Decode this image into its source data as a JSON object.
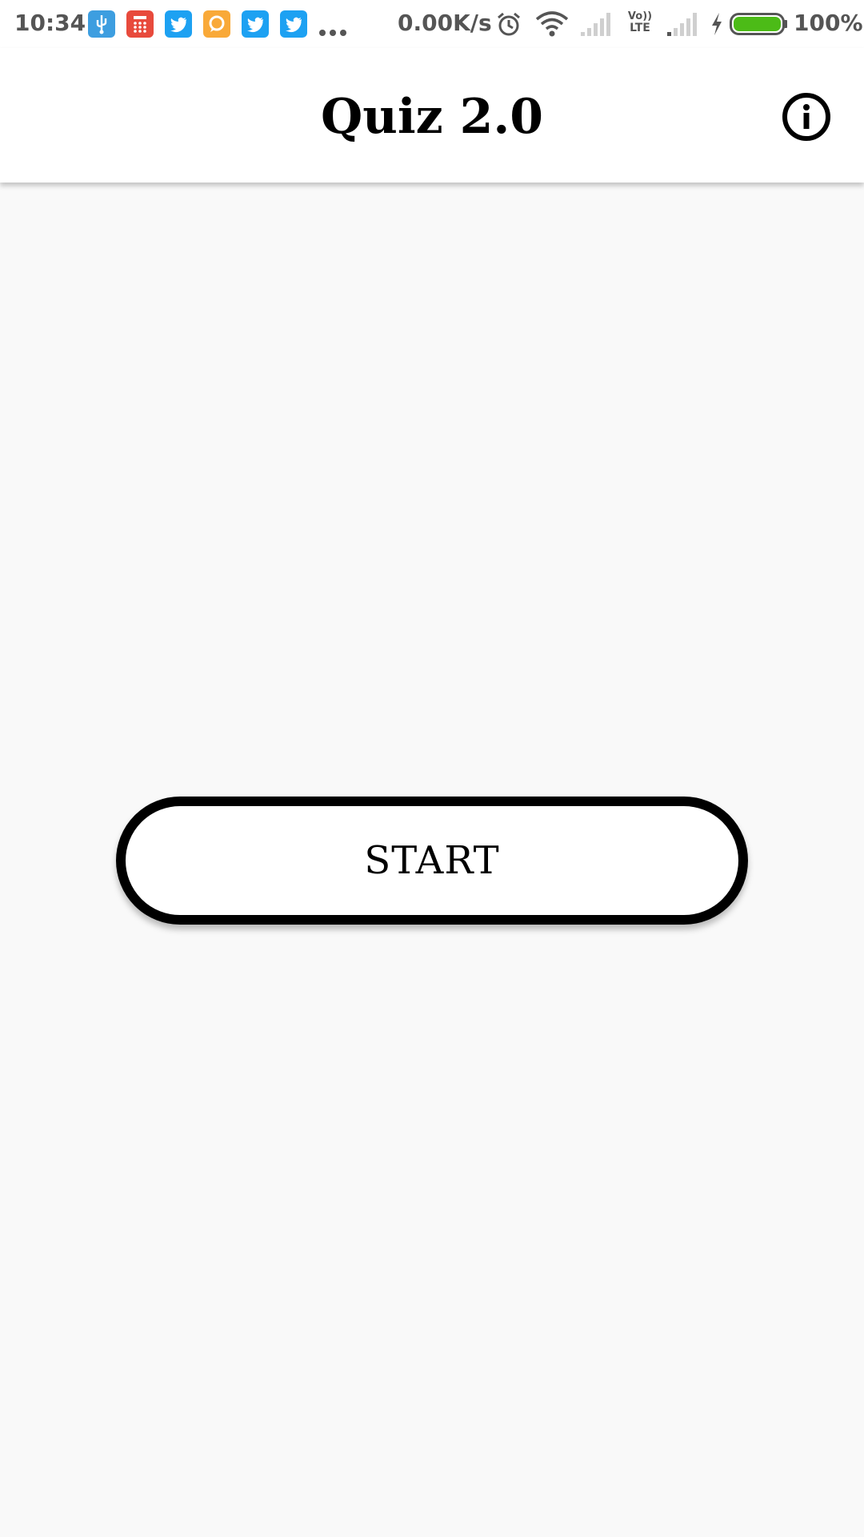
{
  "status_bar": {
    "time": "10:34",
    "notification_icons": [
      {
        "name": "usb-icon",
        "color": "#3d9ee0"
      },
      {
        "name": "calculator-icon",
        "color": "#e84a3c"
      },
      {
        "name": "twitter-icon",
        "color": "#1da1f2"
      },
      {
        "name": "chat-icon",
        "color": "#f9a938"
      },
      {
        "name": "twitter-icon",
        "color": "#1da1f2"
      },
      {
        "name": "twitter-icon",
        "color": "#1da1f2"
      }
    ],
    "network_speed": "0.00K/s",
    "volte_label_top": "Vo))",
    "volte_label_bottom": "LTE",
    "battery_percent": "100%",
    "battery_color": "#4cbb17"
  },
  "app_bar": {
    "title": "Quiz 2.0"
  },
  "main": {
    "start_label": "START"
  }
}
